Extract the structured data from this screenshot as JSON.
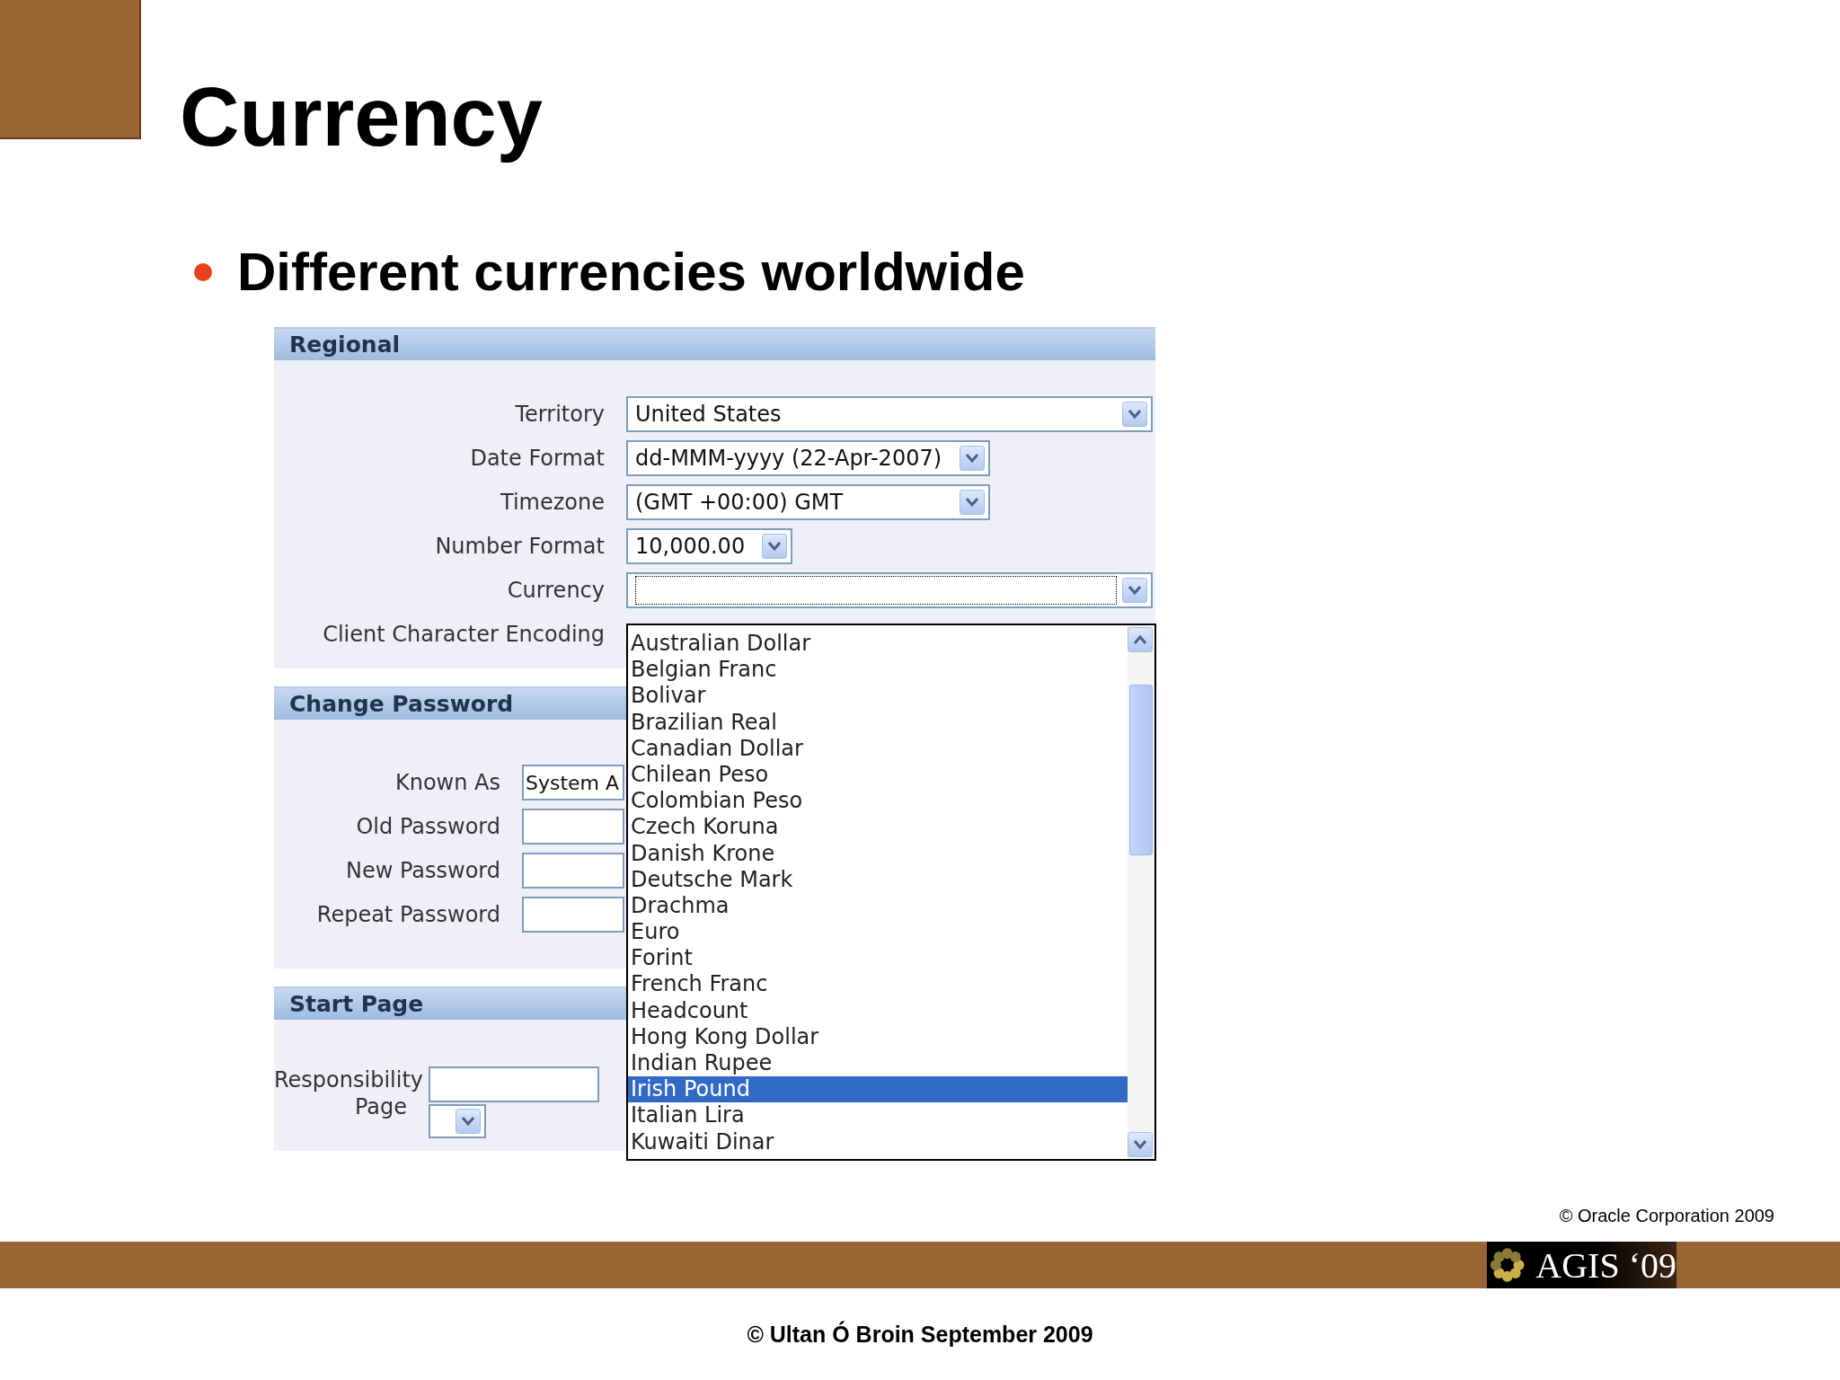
{
  "slide": {
    "title": "Currency",
    "bullets": [
      "Different currencies worldwide"
    ],
    "copyright": "© Oracle Corporation 2009",
    "logo": "AGIS ‘09",
    "footer": "© Ultan Ó Broin September 2009"
  },
  "regional": {
    "title": "Regional",
    "fields": [
      {
        "label": "Territory",
        "kind": "select",
        "value": "United States"
      },
      {
        "label": "Date Format",
        "kind": "select",
        "value": "dd-MMM-yyyy (22-Apr-2007)"
      },
      {
        "label": "Timezone",
        "kind": "select",
        "value": "(GMT +00:00) GMT"
      },
      {
        "label": "Number Format",
        "kind": "select",
        "value": "10,000.00"
      },
      {
        "label": "Currency",
        "kind": "select",
        "focused": true
      },
      {
        "label": "Client Character Encoding",
        "kind": "covered"
      }
    ]
  },
  "change_password": {
    "title": "Change Password",
    "fields": [
      {
        "label": "Known As",
        "value": "System A"
      },
      {
        "label": "Old Password"
      },
      {
        "label": "New Password"
      },
      {
        "label": "Repeat Password"
      }
    ]
  },
  "start_page": {
    "title": "Start Page",
    "label": "Responsibility Page"
  },
  "currency_dropdown": {
    "options": [
      {
        "label": "Australian Dollar",
        "selected": false
      },
      {
        "label": "Belgian Franc",
        "selected": false
      },
      {
        "label": "Bolivar",
        "selected": false
      },
      {
        "label": "Brazilian Real",
        "selected": false
      },
      {
        "label": "Canadian Dollar",
        "selected": false
      },
      {
        "label": "Chilean Peso",
        "selected": false
      },
      {
        "label": "Colombian Peso",
        "selected": false
      },
      {
        "label": "Czech Koruna",
        "selected": false
      },
      {
        "label": "Danish Krone",
        "selected": false
      },
      {
        "label": "Deutsche Mark",
        "selected": false
      },
      {
        "label": "Drachma",
        "selected": false
      },
      {
        "label": "Euro",
        "selected": false
      },
      {
        "label": "Forint",
        "selected": false
      },
      {
        "label": "French Franc",
        "selected": false
      },
      {
        "label": "Headcount",
        "selected": false
      },
      {
        "label": "Hong Kong Dollar",
        "selected": false
      },
      {
        "label": "Indian Rupee",
        "selected": false
      },
      {
        "label": "Irish Pound",
        "selected": true
      },
      {
        "label": "Italian Lira",
        "selected": false
      },
      {
        "label": "Kuwaiti Dinar",
        "selected": false
      }
    ]
  }
}
